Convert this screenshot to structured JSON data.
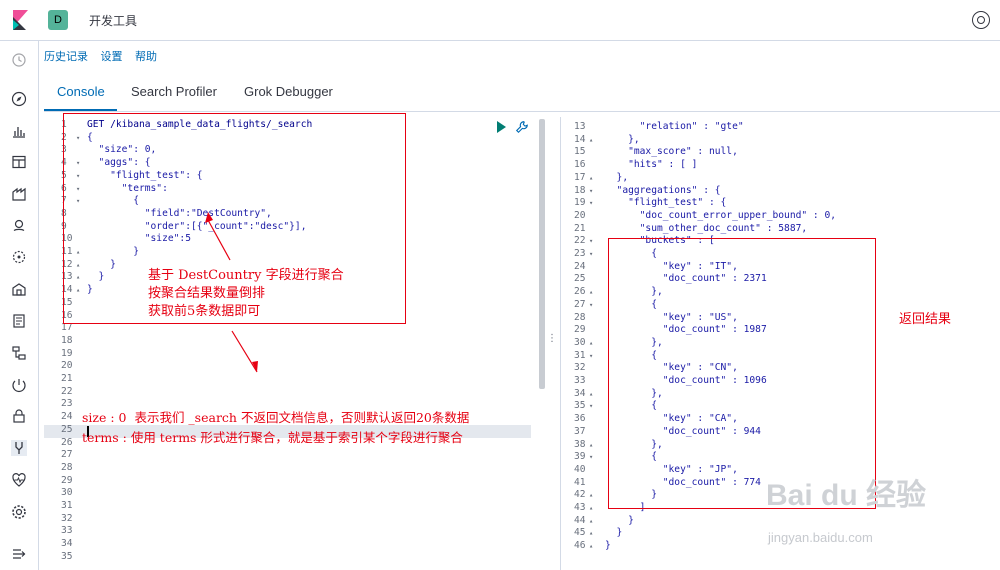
{
  "topbar": {
    "space_initial": "D",
    "title": "开发工具"
  },
  "menu": {
    "history": "历史记录",
    "settings": "设置",
    "help": "帮助"
  },
  "tabs": [
    {
      "label": "Console"
    },
    {
      "label": "Search Profiler"
    },
    {
      "label": "Grok Debugger"
    }
  ],
  "editor": {
    "lines": [
      {
        "n": "1",
        "fold": "",
        "text": "GET /kibana_sample_data_flights/_search"
      },
      {
        "n": "2",
        "fold": "▾",
        "text": "{"
      },
      {
        "n": "3",
        "fold": "",
        "text": "  \"size\": 0,"
      },
      {
        "n": "4",
        "fold": "▾",
        "text": "  \"aggs\": {"
      },
      {
        "n": "5",
        "fold": "▾",
        "text": "    \"flight_test\": {"
      },
      {
        "n": "6",
        "fold": "▾",
        "text": "      \"terms\":"
      },
      {
        "n": "7",
        "fold": "▾",
        "text": "        {"
      },
      {
        "n": "8",
        "fold": "",
        "text": "          \"field\":\"DestCountry\","
      },
      {
        "n": "9",
        "fold": "",
        "text": "          \"order\":[{\"_count\":\"desc\"}],"
      },
      {
        "n": "10",
        "fold": "",
        "text": "          \"size\":5"
      },
      {
        "n": "11",
        "fold": "▴",
        "text": "        }"
      },
      {
        "n": "12",
        "fold": "▴",
        "text": "    }"
      },
      {
        "n": "13",
        "fold": "▴",
        "text": "  }"
      },
      {
        "n": "14",
        "fold": "▴",
        "text": "}"
      },
      {
        "n": "15",
        "fold": "",
        "text": ""
      },
      {
        "n": "16",
        "fold": "",
        "text": ""
      },
      {
        "n": "17",
        "fold": "",
        "text": ""
      },
      {
        "n": "18",
        "fold": "",
        "text": ""
      },
      {
        "n": "19",
        "fold": "",
        "text": ""
      },
      {
        "n": "20",
        "fold": "",
        "text": ""
      },
      {
        "n": "21",
        "fold": "",
        "text": ""
      },
      {
        "n": "22",
        "fold": "",
        "text": ""
      },
      {
        "n": "23",
        "fold": "",
        "text": ""
      },
      {
        "n": "24",
        "fold": "",
        "text": ""
      },
      {
        "n": "25",
        "fold": "",
        "text": ""
      },
      {
        "n": "26",
        "fold": "",
        "text": ""
      },
      {
        "n": "27",
        "fold": "",
        "text": ""
      },
      {
        "n": "28",
        "fold": "",
        "text": ""
      },
      {
        "n": "29",
        "fold": "",
        "text": ""
      },
      {
        "n": "30",
        "fold": "",
        "text": ""
      },
      {
        "n": "31",
        "fold": "",
        "text": ""
      },
      {
        "n": "32",
        "fold": "",
        "text": ""
      },
      {
        "n": "33",
        "fold": "",
        "text": ""
      },
      {
        "n": "34",
        "fold": "",
        "text": ""
      },
      {
        "n": "35",
        "fold": "",
        "text": ""
      }
    ]
  },
  "output": {
    "lines": [
      {
        "n": "13",
        "fold": "",
        "text": "      \"relation\" : \"gte\""
      },
      {
        "n": "14",
        "fold": "▴",
        "text": "    },"
      },
      {
        "n": "15",
        "fold": "",
        "text": "    \"max_score\" : null,"
      },
      {
        "n": "16",
        "fold": "",
        "text": "    \"hits\" : [ ]"
      },
      {
        "n": "17",
        "fold": "▴",
        "text": "  },"
      },
      {
        "n": "18",
        "fold": "▾",
        "text": "  \"aggregations\" : {"
      },
      {
        "n": "19",
        "fold": "▾",
        "text": "    \"flight_test\" : {"
      },
      {
        "n": "20",
        "fold": "",
        "text": "      \"doc_count_error_upper_bound\" : 0,"
      },
      {
        "n": "21",
        "fold": "",
        "text": "      \"sum_other_doc_count\" : 5887,"
      },
      {
        "n": "22",
        "fold": "▾",
        "text": "      \"buckets\" : ["
      },
      {
        "n": "23",
        "fold": "▾",
        "text": "        {"
      },
      {
        "n": "24",
        "fold": "",
        "text": "          \"key\" : \"IT\","
      },
      {
        "n": "25",
        "fold": "",
        "text": "          \"doc_count\" : 2371"
      },
      {
        "n": "26",
        "fold": "▴",
        "text": "        },"
      },
      {
        "n": "27",
        "fold": "▾",
        "text": "        {"
      },
      {
        "n": "28",
        "fold": "",
        "text": "          \"key\" : \"US\","
      },
      {
        "n": "29",
        "fold": "",
        "text": "          \"doc_count\" : 1987"
      },
      {
        "n": "30",
        "fold": "▴",
        "text": "        },"
      },
      {
        "n": "31",
        "fold": "▾",
        "text": "        {"
      },
      {
        "n": "32",
        "fold": "",
        "text": "          \"key\" : \"CN\","
      },
      {
        "n": "33",
        "fold": "",
        "text": "          \"doc_count\" : 1096"
      },
      {
        "n": "34",
        "fold": "▴",
        "text": "        },"
      },
      {
        "n": "35",
        "fold": "▾",
        "text": "        {"
      },
      {
        "n": "36",
        "fold": "",
        "text": "          \"key\" : \"CA\","
      },
      {
        "n": "37",
        "fold": "",
        "text": "          \"doc_count\" : 944"
      },
      {
        "n": "38",
        "fold": "▴",
        "text": "        },"
      },
      {
        "n": "39",
        "fold": "▾",
        "text": "        {"
      },
      {
        "n": "40",
        "fold": "",
        "text": "          \"key\" : \"JP\","
      },
      {
        "n": "41",
        "fold": "",
        "text": "          \"doc_count\" : 774"
      },
      {
        "n": "42",
        "fold": "▴",
        "text": "        }"
      },
      {
        "n": "43",
        "fold": "▴",
        "text": "      ]"
      },
      {
        "n": "44",
        "fold": "▴",
        "text": "    }"
      },
      {
        "n": "45",
        "fold": "▴",
        "text": "  }"
      },
      {
        "n": "46",
        "fold": "▴",
        "text": "}"
      }
    ]
  },
  "annotations": {
    "query_note_1": "基于 DestCountry 字段进行聚合",
    "query_note_2": "按聚合结果数量倒排",
    "query_note_3": "获取前5条数据即可",
    "size_note": "size : 0  表示我们 _search 不返回文档信息，否则默认返回20条数据",
    "terms_note": "terms : 使用 terms 形式进行聚合，就是基于索引某个字段进行聚合",
    "result_note": "返回结果"
  },
  "watermark": {
    "main": "Bai du 经验",
    "sub": "jingyan.baidu.com"
  },
  "colors": {
    "accent": "#006bb4",
    "annotation": "#e60012",
    "play": "#017d73"
  }
}
